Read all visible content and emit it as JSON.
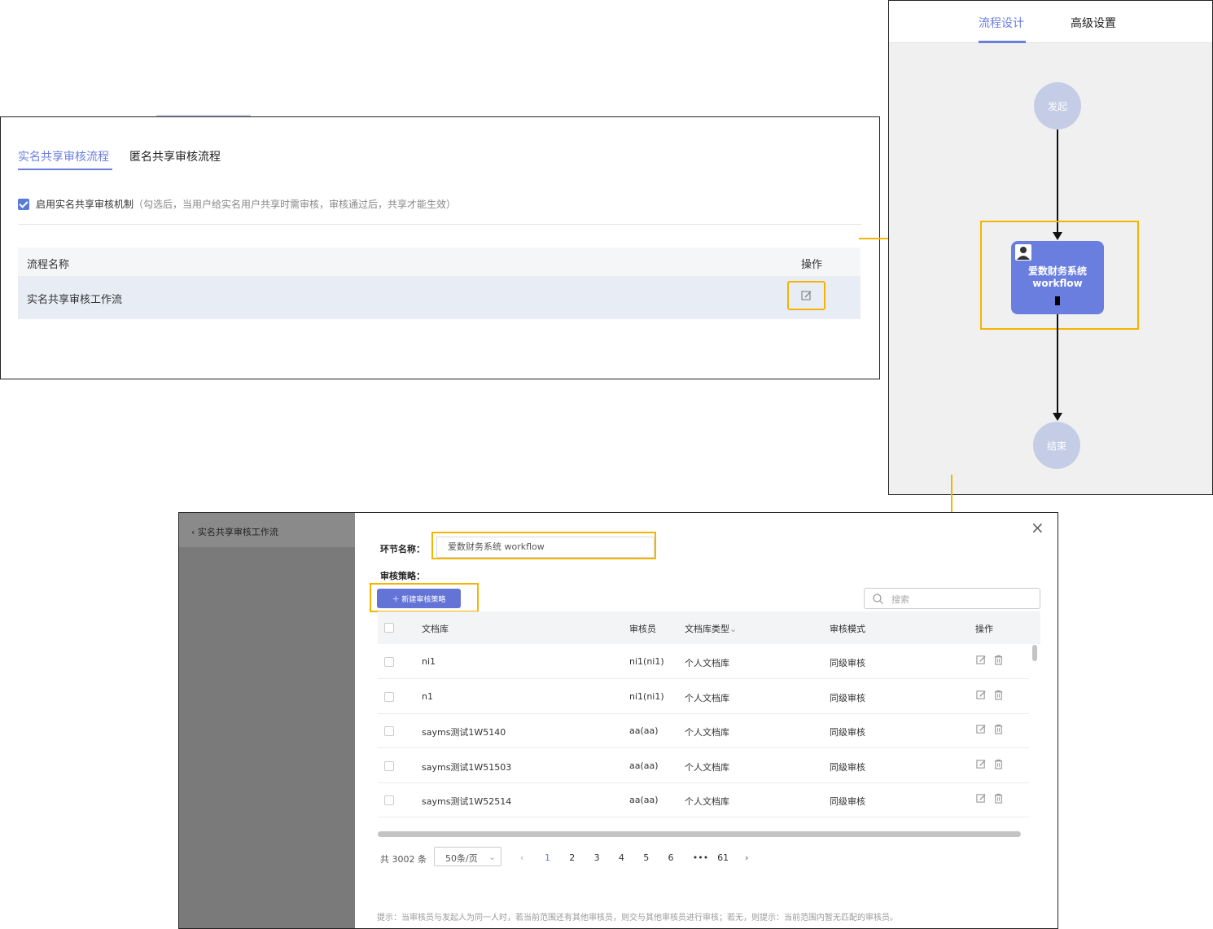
{
  "panel_share": {
    "tabs": [
      "实名共享审核流程",
      "匿名共享审核流程"
    ],
    "enable_label": "启用实名共享审核机制",
    "enable_hint": "（勾选后，当用户给实名用户共享时需审核，审核通过后，共享才能生效）",
    "table_headers": [
      "流程名称",
      "操作"
    ],
    "rows": [
      {
        "name": "实名共享审核工作流"
      }
    ]
  },
  "panel_flow": {
    "tabs": [
      "流程设计",
      "高级设置"
    ],
    "start_label": "发起",
    "end_label": "结束",
    "node_line1": "爱数财务系统",
    "node_line2": "workflow"
  },
  "panel_dialog": {
    "back_label": "实名共享审核工作流",
    "close_icon": "×",
    "node_name_label": "环节名称：",
    "node_name_value": "爱数财务系统    workflow",
    "strategy_label": "审核策略：",
    "new_strategy_label": "＋ 新建审核策略",
    "search_placeholder": "搜索",
    "table_headers": [
      "文档库",
      "审核员",
      "文档库类型",
      "审核模式",
      "操作"
    ],
    "rows": [
      {
        "library": "ni1",
        "auditor": "ni1(ni1)",
        "type": "个人文档库",
        "mode": "同级审核"
      },
      {
        "library": "n1",
        "auditor": "ni1(ni1)",
        "type": "个人文档库",
        "mode": "同级审核"
      },
      {
        "library": "sayms测试1W5140",
        "auditor": "aa(aa)",
        "type": "个人文档库",
        "mode": "同级审核"
      },
      {
        "library": "sayms测试1W51503",
        "auditor": "aa(aa)",
        "type": "个人文档库",
        "mode": "同级审核"
      },
      {
        "library": "sayms测试1W52514",
        "auditor": "aa(aa)",
        "type": "个人文档库",
        "mode": "同级审核"
      }
    ],
    "pagination": {
      "total": "共 3002 条",
      "page_size": "50条/页",
      "pages": [
        "1",
        "2",
        "3",
        "4",
        "5",
        "6",
        "•••",
        "61"
      ],
      "current": "1",
      "prev": "‹",
      "next": "›"
    },
    "hint": "提示：当审核员与发起人为同一人时，若当前范围还有其他审核员，则交与其他审核员进行审核；若无，则提示：当前范围内暂无匹配的审核员。"
  },
  "colors": {
    "accent": "#6b7ee0",
    "highlight": "#f4b400",
    "node": "#6a7ee0"
  }
}
